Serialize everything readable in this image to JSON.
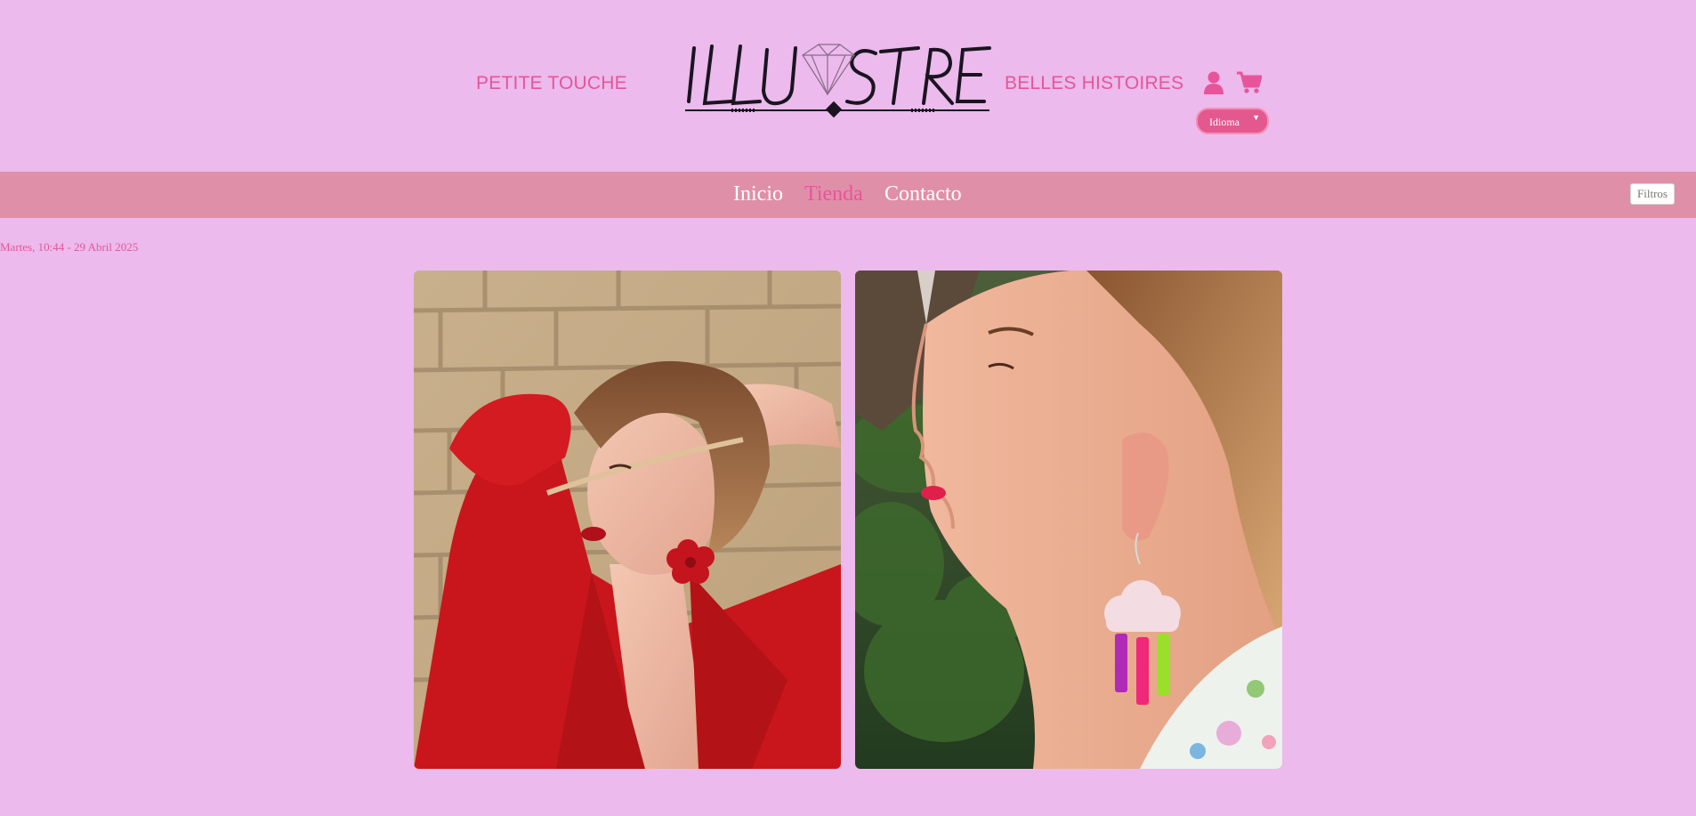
{
  "header": {
    "left_link": "PETITE TOUCHE",
    "right_link": "BELLES HISTOIRES",
    "logo_text": "ILLUSTRE",
    "language_select": "Idioma"
  },
  "menu": {
    "items": [
      {
        "label": "Inicio",
        "active": false
      },
      {
        "label": "Tienda",
        "active": true
      },
      {
        "label": "Contacto",
        "active": false
      }
    ],
    "filter_button": "Filtros"
  },
  "datetime": "Martes, 10:44 - 29 Abril 2025",
  "products": [
    {
      "image": "woman-red-blazer-flower-earring"
    },
    {
      "image": "woman-profile-cloud-rainbow-earring"
    }
  ],
  "colors": {
    "background": "#ecbaec",
    "accent": "#e8549a",
    "menubar": "#e08fa9"
  }
}
